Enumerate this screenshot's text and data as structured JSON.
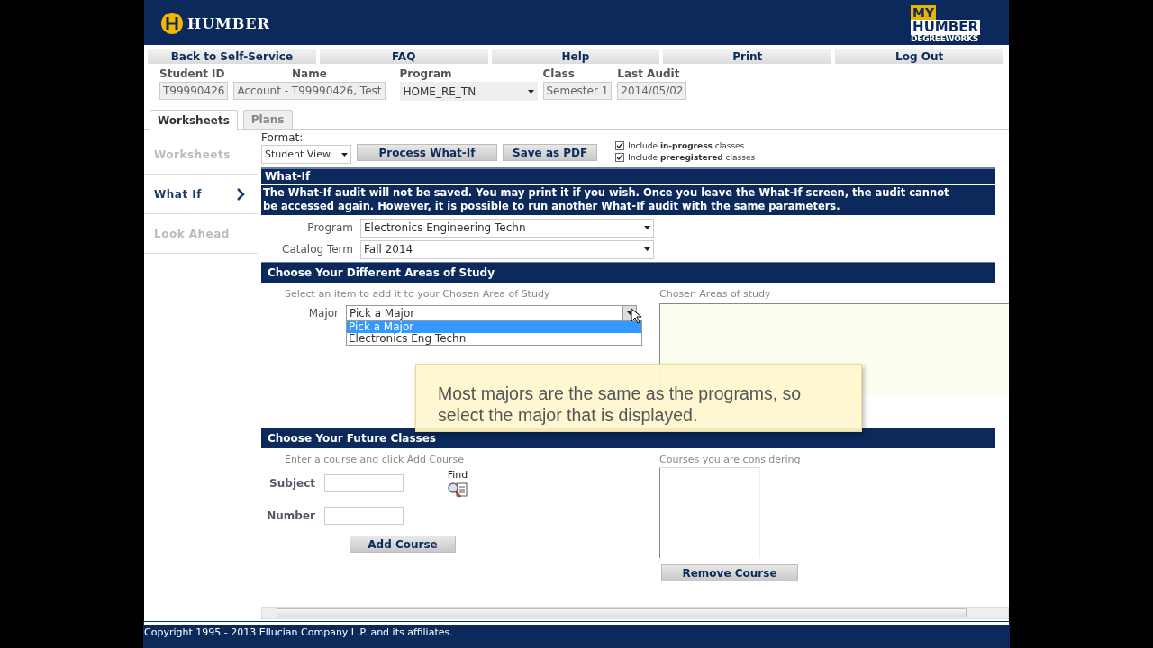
{
  "header": {
    "logo": "HUMBER",
    "badge": [
      "MY",
      "HUMBER",
      "DEGREEWORKS"
    ]
  },
  "nav": [
    "Back to Self-Service",
    "FAQ",
    "Help",
    "Print",
    "Log Out"
  ],
  "student": [
    {
      "label": "Student ID",
      "value": "T99990426",
      "kind": "field"
    },
    {
      "label": "Name",
      "value": "Account - T99990426, Test",
      "kind": "field"
    },
    {
      "label": "Program",
      "value": "HOME_RE_TN",
      "kind": "select"
    },
    {
      "label": "Class",
      "value": "Semester 1",
      "kind": "field"
    },
    {
      "label": "Last Audit",
      "value": "2014/05/02",
      "kind": "field"
    }
  ],
  "tabs": [
    {
      "label": "Worksheets",
      "selected": true
    },
    {
      "label": "Plans",
      "selected": false
    }
  ],
  "sidebar": [
    {
      "label": "Worksheets",
      "selected": false
    },
    {
      "label": "What If",
      "selected": true
    },
    {
      "label": "Look Ahead",
      "selected": false
    }
  ],
  "toolbar": {
    "format_label": "Format:",
    "format_value": "Student View",
    "buttons": [
      "Process What-If",
      "Save as PDF"
    ],
    "options": [
      {
        "text": "Include **in-progress** classes",
        "checked": true
      },
      {
        "text": "Include **preregistered** classes",
        "checked": true
      }
    ]
  },
  "what_if": {
    "title": "What-If",
    "notice": "The What-If audit will not be saved. You may print it if you wish. Once you leave the What-If screen, the audit cannot be accessed again. However, it is possible to run another What-If audit with the same parameters.",
    "fields": [
      {
        "label": "Program",
        "value": "Electronics Engineering Techn"
      },
      {
        "label": "Catalog Term",
        "value": "Fall 2014"
      }
    ]
  },
  "areas": {
    "title": "Choose Your Different Areas of Study",
    "hint": "Select an item to add it to your Chosen Area of Study",
    "major_label": "Major",
    "major_value": "Pick a Major",
    "options": [
      {
        "label": "Pick a Major",
        "selected": true
      },
      {
        "label": "Electronics Eng Techn",
        "selected": false
      }
    ],
    "chosen_label": "Chosen Areas of study"
  },
  "tooltip": "Most majors are the same as the programs, so select the major that is displayed.",
  "future": {
    "title": "Choose Your Future Classes",
    "hint": "Enter a course and click Add Course",
    "fields": [
      "Subject",
      "Number"
    ],
    "find": "Find",
    "add_button": "Add Course",
    "considering_label": "Courses you are considering",
    "remove_button": "Remove Course"
  },
  "footer": "Copyright 1995 - 2013 Ellucian Company L.P. and its affiliates."
}
